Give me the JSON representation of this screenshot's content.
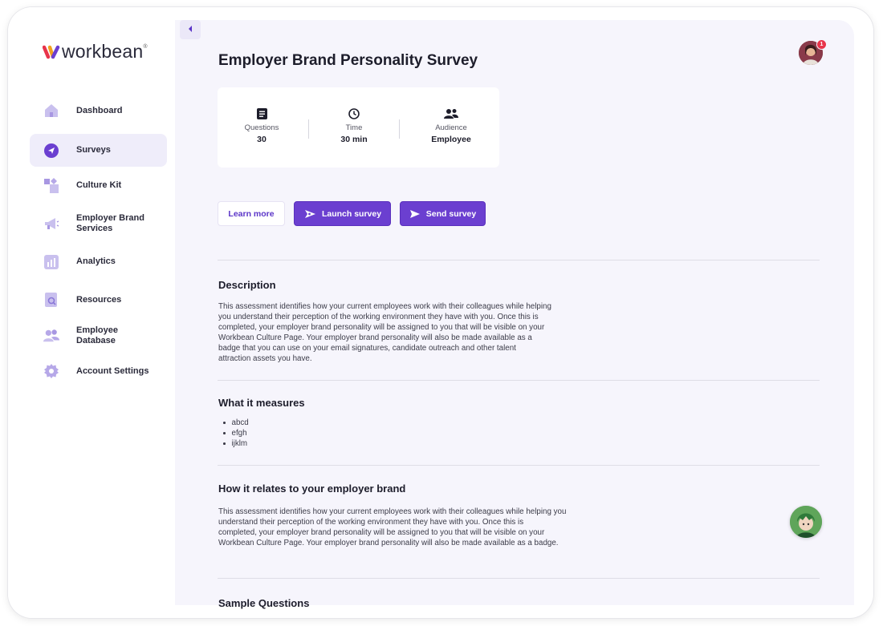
{
  "brand": {
    "name": "workbean",
    "reg": "®",
    "accent": "#6b3fd0"
  },
  "sidebar": {
    "items": [
      {
        "label": "Dashboard",
        "icon": "home-icon"
      },
      {
        "label": "Surveys",
        "icon": "send-circle-icon",
        "active": true
      },
      {
        "label": "Culture Kit",
        "icon": "blocks-icon"
      },
      {
        "label": "Employer Brand Services",
        "line1": "Employer Brand",
        "line2": "Services",
        "icon": "megaphone-icon"
      },
      {
        "label": "Analytics",
        "icon": "bar-chart-icon"
      },
      {
        "label": "Resources",
        "icon": "doc-search-icon"
      },
      {
        "label": "Employee Database",
        "line1": "Employee",
        "line2": "Database",
        "icon": "people-icon"
      },
      {
        "label": "Account Settings",
        "icon": "gear-icon"
      }
    ]
  },
  "header": {
    "title": "Employer Brand Personality Survey",
    "notification_count": "1"
  },
  "stats": [
    {
      "label": "Questions",
      "value": "30",
      "icon": "list-icon"
    },
    {
      "label": "Time",
      "value": "30 min",
      "icon": "clock-icon"
    },
    {
      "label": "Audience",
      "value": "Employee",
      "icon": "users-icon"
    }
  ],
  "actions": {
    "learn_more": "Learn more",
    "launch": "Launch survey",
    "send": "Send survey"
  },
  "sections": {
    "description": {
      "title": "Description",
      "lines": [
        "This assessment identifies how your current employees work with their colleagues while  helping",
        "you understand their perception of the working environment they have with you.  Once this is",
        "completed, your employer brand personality will be assigned to you that will be visible on  your",
        "Workbean Culture Page. Your employer brand personality will also be made available as a",
        "badge  that you can use on your email signatures, candidate outreach and other talent",
        "attraction  assets you have."
      ]
    },
    "measures": {
      "title": "What it measures",
      "items": [
        "abcd",
        "efgh",
        "ijklm"
      ]
    },
    "relates": {
      "title": "How it relates to your employer brand",
      "lines": [
        "This assessment identifies how your current employees work with their colleagues while  helping you",
        "understand their perception of the working environment they have with you.  Once this is",
        "completed, your employer brand personality will be assigned to you that will be visible on  your",
        "Workbean Culture Page. Your employer brand personality will also be made available as a badge."
      ]
    },
    "sample": {
      "title": "Sample Questions"
    }
  }
}
